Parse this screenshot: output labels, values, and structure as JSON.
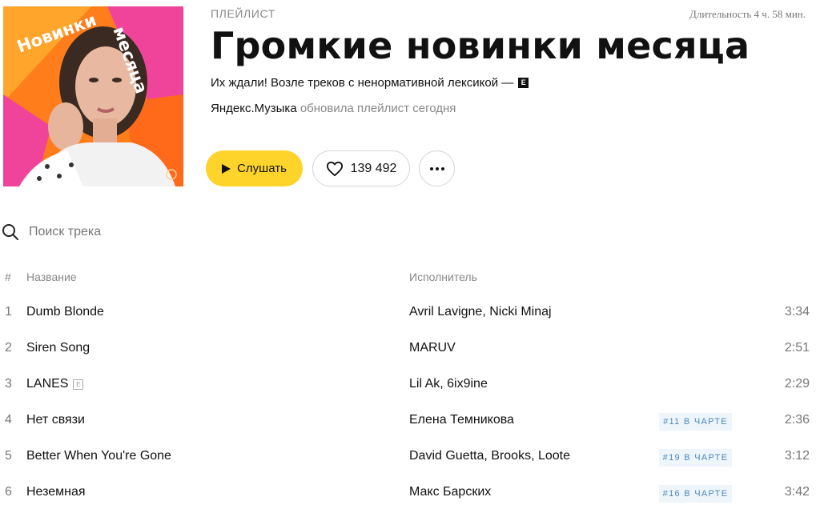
{
  "playlist": {
    "kind_label": "ПЛЕЙЛИСТ",
    "duration": "Длительность 4 ч. 58 мин.",
    "title": "Громкие новинки месяца",
    "description": "Их ждали! Возле треков с ненормативной лексикой —",
    "explicit_badge": "E",
    "owner": "Яндекс.Музыка",
    "updated_text": "обновила плейлист сегодня",
    "cover_text_1": "Новинки",
    "cover_text_2": "месяца"
  },
  "actions": {
    "play_label": "Слушать",
    "likes_count": "139 492",
    "more_icon": "more-dots-icon",
    "play_icon": "play-icon",
    "like_icon": "heart-icon"
  },
  "search": {
    "placeholder": "Поиск трека",
    "icon": "search-icon"
  },
  "table": {
    "headers": {
      "num": "#",
      "name": "Название",
      "artist": "Исполнитель"
    },
    "rows": [
      {
        "num": "1",
        "name": "Dumb Blonde",
        "explicit": "",
        "artist": "Avril Lavigne, Nicki Minaj",
        "chart": "",
        "duration": "3:34"
      },
      {
        "num": "2",
        "name": "Siren Song",
        "explicit": "",
        "artist": "MARUV",
        "chart": "",
        "duration": "2:51"
      },
      {
        "num": "3",
        "name": "LANES",
        "explicit": "E",
        "artist": "Lil Ak, 6ix9ine",
        "chart": "",
        "duration": "2:29"
      },
      {
        "num": "4",
        "name": "Нет связи",
        "explicit": "",
        "artist": "Елена Темникова",
        "chart": "#11 В ЧАРТЕ",
        "duration": "2:36"
      },
      {
        "num": "5",
        "name": "Better When You're Gone",
        "explicit": "",
        "artist": "David Guetta, Brooks, Loote",
        "chart": "#19 В ЧАРТЕ",
        "duration": "3:12"
      },
      {
        "num": "6",
        "name": "Неземная",
        "explicit": "",
        "artist": "Макс Барских",
        "chart": "#16 В ЧАРТЕ",
        "duration": "3:42"
      }
    ]
  },
  "colors": {
    "play_button": "#fed42b",
    "chart_badge_bg": "#eef5fb",
    "chart_badge_text": "#4a89c2",
    "cover_orange": "#ff7d1a",
    "cover_pink": "#f0449a"
  }
}
